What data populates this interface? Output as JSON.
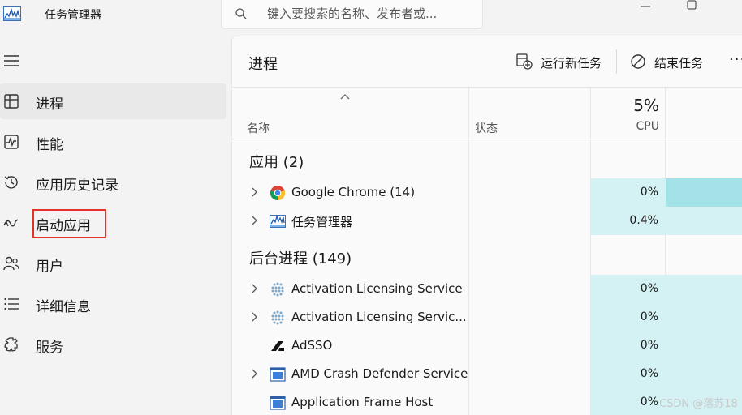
{
  "app": {
    "title": "任务管理器",
    "logo_icon": "task-manager-logo-icon"
  },
  "search": {
    "placeholder": "键入要搜索的名称、发布者或..."
  },
  "sidebar": {
    "items": [
      {
        "label": "进程",
        "icon": "processes-icon",
        "active": true
      },
      {
        "label": "性能",
        "icon": "performance-icon",
        "active": false
      },
      {
        "label": "应用历史记录",
        "icon": "app-history-icon",
        "active": false
      },
      {
        "label": "启动应用",
        "icon": "startup-apps-icon",
        "active": false
      },
      {
        "label": "用户",
        "icon": "users-icon",
        "active": false
      },
      {
        "label": "详细信息",
        "icon": "details-icon",
        "active": false
      },
      {
        "label": "服务",
        "icon": "services-icon",
        "active": false
      }
    ]
  },
  "main": {
    "title": "进程",
    "toolbar": {
      "run_new_task": "运行新任务",
      "end_task": "结束任务",
      "more": "···"
    },
    "columns": {
      "name": "名称",
      "status": "状态",
      "cpu_total": "5%",
      "cpu": "CPU"
    },
    "groups": [
      {
        "label": "应用 (2)",
        "rows": [
          {
            "name": "Google Chrome (14)",
            "cpu": "0%",
            "icon": "chrome-icon",
            "expandable": true
          },
          {
            "name": "任务管理器",
            "cpu": "0.4%",
            "icon": "task-manager-icon",
            "expandable": true
          }
        ]
      },
      {
        "label": "后台进程 (149)",
        "rows": [
          {
            "name": "Activation Licensing Service",
            "cpu": "0%",
            "icon": "service-dots-icon",
            "expandable": true
          },
          {
            "name": "Activation Licensing Servic...",
            "cpu": "0%",
            "icon": "service-dots-icon",
            "expandable": true
          },
          {
            "name": "AdSSO",
            "cpu": "0%",
            "icon": "autodesk-icon",
            "expandable": false
          },
          {
            "name": "AMD Crash Defender Service",
            "cpu": "0%",
            "icon": "app-window-icon",
            "expandable": true
          },
          {
            "name": "Application Frame Host",
            "cpu": "0%",
            "icon": "app-window-icon",
            "expandable": false
          }
        ]
      }
    ]
  },
  "watermark": "CSDN @落苏18",
  "colors": {
    "cpu_cell": "#d4f2f4",
    "cpu_cell_dark": "#a3e3e8",
    "highlight_border": "#e0312b"
  }
}
